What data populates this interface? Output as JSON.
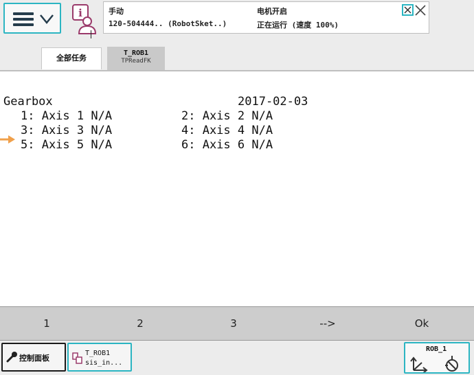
{
  "status": {
    "mode": "手动",
    "controller": "120-504444..  (RobotSket..)",
    "motor_state": "电机开启",
    "run_state": "正在运行 (速度 100%)"
  },
  "tabs": {
    "all_tasks": "全部任务",
    "task_name": "T_ROB1",
    "task_module": "TPReadFK"
  },
  "screen": {
    "title": "Gearbox",
    "date": "2017-02-03",
    "axes": [
      {
        "label": "1: Axis 1 N/A"
      },
      {
        "label": "2: Axis 2 N/A"
      },
      {
        "label": "3: Axis 3 N/A"
      },
      {
        "label": "4: Axis 4 N/A"
      },
      {
        "label": "5: Axis 5 N/A"
      },
      {
        "label": "6: Axis 6 N/A"
      }
    ]
  },
  "function_keys": [
    "1",
    "2",
    "3",
    "-->",
    "Ok"
  ],
  "taskbar": {
    "control_panel": "控制面板",
    "task_line1": "T_ROB1",
    "task_line2": "sis_in...",
    "robot": "ROB_1"
  },
  "colors": {
    "accent": "#2bb5c2",
    "program_pointer": "#f0a04b",
    "fkey_bar": "#cdcdcd"
  },
  "icons": [
    "menu-icon",
    "chevron-down-icon",
    "info-icon",
    "window-controls-icon",
    "program-pointer-icon",
    "wrench-icon",
    "task-icon",
    "robot-jog-icon"
  ]
}
